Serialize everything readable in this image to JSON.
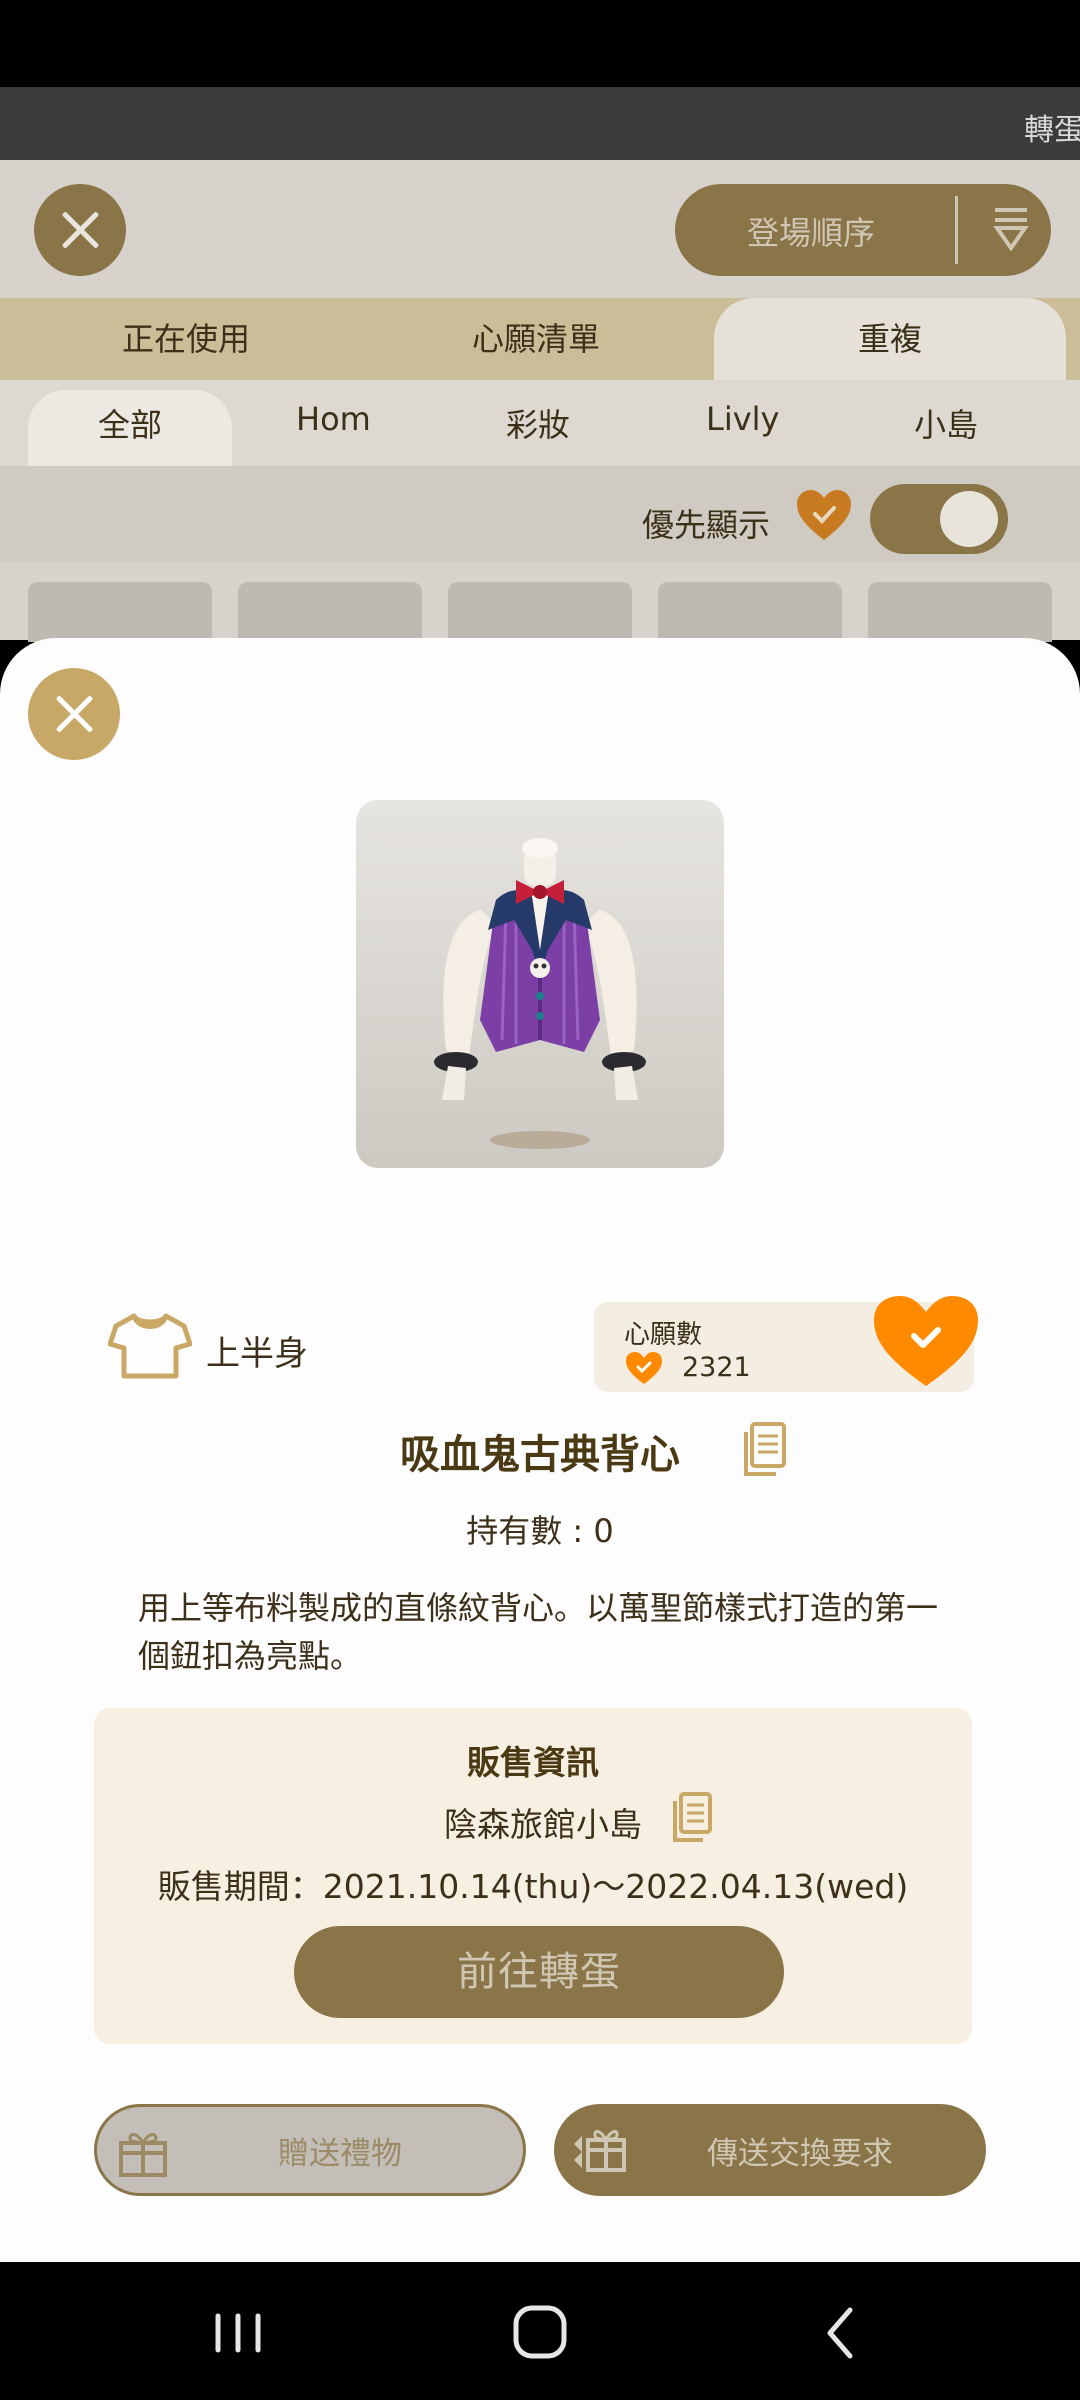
{
  "title_bar": {
    "marquee_text": "轉蛋"
  },
  "background": {
    "sort_label": "登場順序",
    "tabs": [
      "正在使用",
      "心願清單",
      "重複"
    ],
    "sub_tabs": [
      "全部",
      "Hom",
      "彩妝",
      "Livly",
      "小島"
    ],
    "filter_label": "優先顯示"
  },
  "item": {
    "category": "上半身",
    "wish_label": "心願數",
    "wish_count": "2321",
    "name": "吸血鬼古典背心",
    "owned": "持有數 : 0",
    "description": "用上等布料製成的直條紋背心。以萬聖節樣式打造的第一個鈕扣為亮點。"
  },
  "sale": {
    "title": "販售資訊",
    "island": "陰森旅館小島",
    "period": "販售期間：2021.10.14(thu)～2022.04.13(wed)",
    "goto_label": "前往轉蛋"
  },
  "actions": {
    "gift_label": "贈送禮物",
    "trade_label": "傳送交換要求"
  },
  "colors": {
    "gold": "#8a7548",
    "light_gold": "#c7a867",
    "heart_orange": "#ff8a00",
    "sale_bg": "#f7efe2"
  }
}
